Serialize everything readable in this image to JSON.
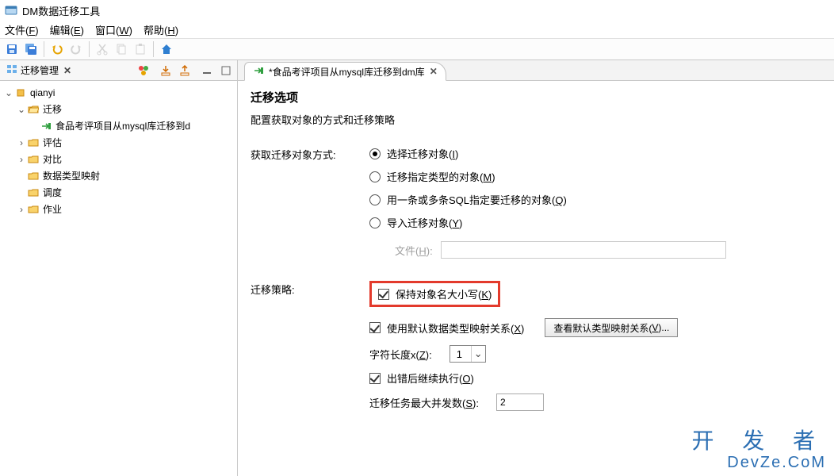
{
  "window": {
    "title": "DM数据迁移工具"
  },
  "menu": {
    "file": "文件(F)",
    "edit": "编辑(E)",
    "window": "窗口(W)",
    "help": "帮助(H)"
  },
  "left_panel": {
    "tab_label": "迁移管理",
    "tree": {
      "root": "qianyi",
      "items": [
        {
          "label": "迁移",
          "children": [
            {
              "label": "食品考评项目从mysql库迁移到d"
            }
          ]
        },
        {
          "label": "评估"
        },
        {
          "label": "对比"
        },
        {
          "label": "数据类型映射"
        },
        {
          "label": "调度"
        },
        {
          "label": "作业"
        }
      ]
    }
  },
  "editor": {
    "tab_label": "*食品考评项目从mysql库迁移到dm库"
  },
  "page": {
    "heading": "迁移选项",
    "subtitle": "配置获取对象的方式和迁移策略",
    "method_label": "获取迁移对象方式:",
    "method_opts": {
      "select": "选择迁移对象(I)",
      "by_type": "迁移指定类型的对象(M)",
      "by_sql": "用一条或多条SQL指定要迁移的对象(Q)",
      "import": "导入迁移对象(Y)"
    },
    "file_label": "文件(H):",
    "strategy_label": "迁移策略:",
    "strategy_opts": {
      "keep_case": "保持对象名大小写(K)",
      "default_mapping": "使用默认数据类型映射关系(X)",
      "view_mapping_btn": "查看默认类型映射关系(V)...",
      "char_len_label": "字符长度x(Z):",
      "char_len_value": "1",
      "continue_on_error": "出错后继续执行(O)",
      "max_parallel_label": "迁移任务最大并发数(S):",
      "max_parallel_value": "2"
    }
  },
  "watermark": {
    "line1": "开 发 者",
    "line2": "DevZe.CoM"
  }
}
